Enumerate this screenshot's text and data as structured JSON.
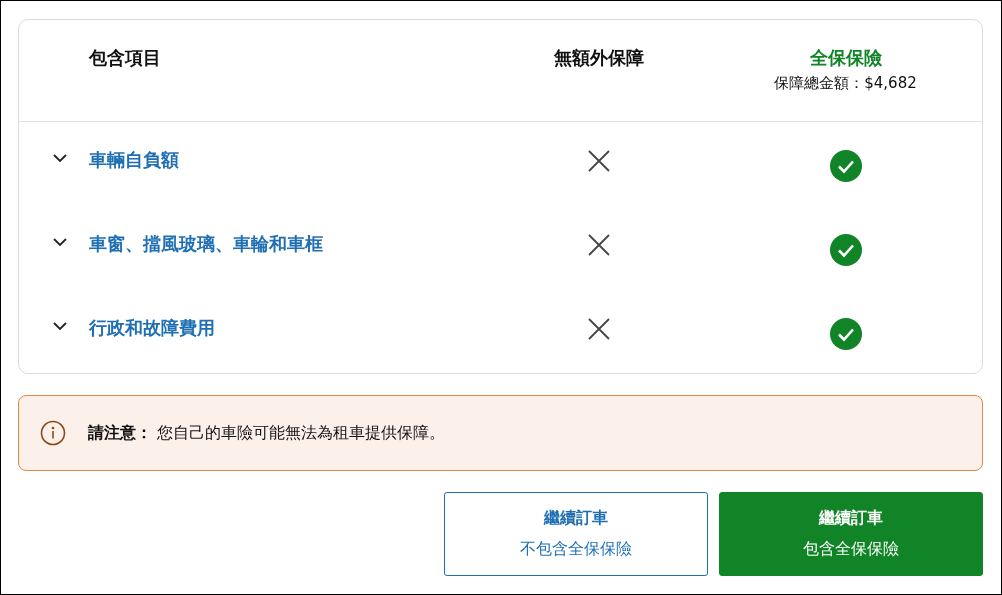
{
  "table": {
    "columns": [
      {
        "label": "包含項目"
      },
      {
        "label": "無額外保障"
      },
      {
        "label": "全保保險",
        "subtitle": "保障總金額：$4,682"
      }
    ],
    "rows": [
      {
        "label": "車輛自負額",
        "expanded": false,
        "basic_included": false,
        "full_included": true
      },
      {
        "label": "車窗、擋風玻璃、車輪和車框",
        "expanded": false,
        "basic_included": false,
        "full_included": true
      },
      {
        "label": "行政和故障費用",
        "expanded": false,
        "basic_included": false,
        "full_included": true
      }
    ]
  },
  "notice": {
    "text": "**請注意：** 您自己的車險可能無法為租車提供保障。"
  },
  "buttons": [
    {
      "kind": "secondary",
      "title": "繼續訂車",
      "subtitle": "不包含全保保險"
    },
    {
      "kind": "primary",
      "title": "繼續訂車",
      "subtitle": "包含全保保險"
    }
  ]
}
